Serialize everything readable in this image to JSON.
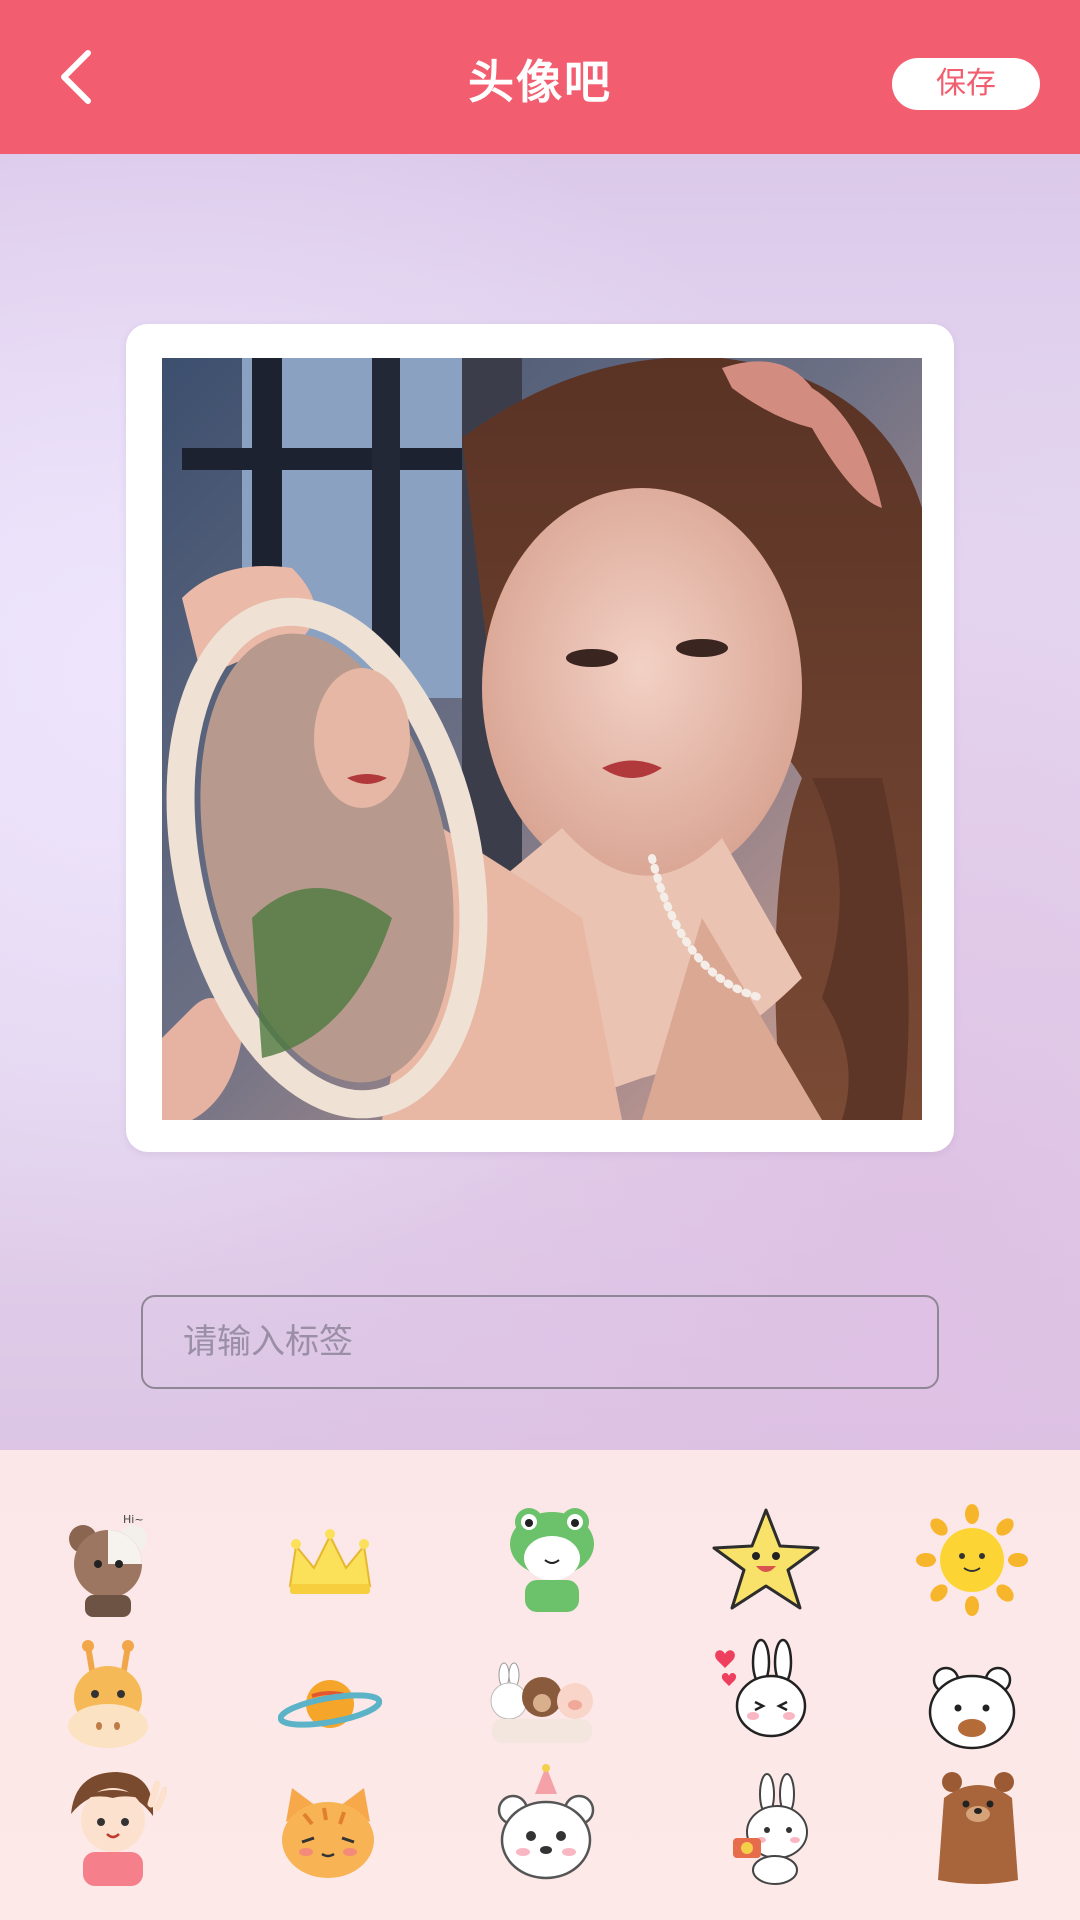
{
  "header": {
    "title": "头像吧",
    "save_label": "保存",
    "back_icon": "chevron-left-icon",
    "bg_color": "#f25e6f"
  },
  "editor": {
    "tag_input": {
      "placeholder": "请输入标签",
      "value": ""
    }
  },
  "stickers": [
    {
      "name": "bear-sticker",
      "text": "Hi~"
    },
    {
      "name": "crown-sticker"
    },
    {
      "name": "frog-sticker"
    },
    {
      "name": "star-sticker"
    },
    {
      "name": "sun-sticker"
    },
    {
      "name": "giraffe-sticker"
    },
    {
      "name": "planet-sticker"
    },
    {
      "name": "animal-friends-sticker"
    },
    {
      "name": "bunny-hearts-sticker"
    },
    {
      "name": "white-bear-sticker"
    },
    {
      "name": "girl-sticker"
    },
    {
      "name": "cat-sticker"
    },
    {
      "name": "party-bear-sticker"
    },
    {
      "name": "bunny-camera-sticker"
    },
    {
      "name": "brown-bear-sticker"
    }
  ]
}
